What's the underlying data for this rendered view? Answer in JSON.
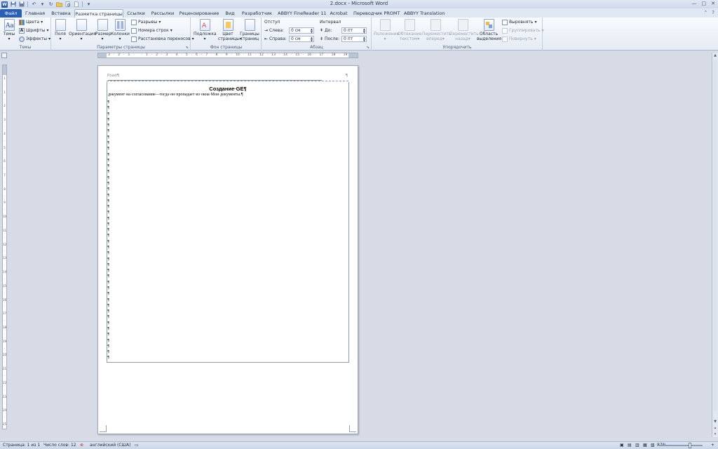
{
  "window": {
    "title": "2.docx - Microsoft Word",
    "app_icon": "W",
    "controls": [
      "—",
      "□",
      "✕"
    ]
  },
  "quick_access": {
    "icons": [
      "save-icon",
      "save-as-icon",
      "undo-icon",
      "redo-icon",
      "open-icon",
      "print-preview-icon",
      "new-icon",
      "customize-icon"
    ]
  },
  "tabs": {
    "file": "Файл",
    "home": "Главная",
    "insert": "Вставка",
    "page_layout": "Разметка страницы",
    "references": "Ссылки",
    "mailings": "Рассылки",
    "review": "Рецензирование",
    "view": "Вид",
    "developer": "Разработчик",
    "finereader": "ABBYY FineReader 11",
    "acrobat": "Acrobat",
    "promt": "Переводчик PROMT",
    "abbyy_translation": "ABBYY Translation"
  },
  "ribbon": {
    "themes": {
      "label": "Темы",
      "themes_btn": "Темы",
      "colors": "Цвета",
      "fonts": "Шрифты",
      "effects": "Эффекты"
    },
    "page_setup": {
      "label": "Параметры страницы",
      "margins": "Поля",
      "orientation": "Ориентация",
      "size": "Размер",
      "columns": "Колонки",
      "breaks": "Разрывы",
      "line_numbers": "Номера строк",
      "hyphenation": "Расстановка переносов"
    },
    "page_background": {
      "label": "Фон страницы",
      "watermark": "Подложка",
      "page_color_1": "Цвет",
      "page_color_2": "страницы",
      "borders_1": "Границы",
      "borders_2": "страниц"
    },
    "paragraph": {
      "label": "Абзац",
      "indent": "Отступ",
      "left": "Слева:",
      "right": "Справа:",
      "left_val": "0 см",
      "right_val": "0 см",
      "spacing": "Интервал",
      "before": "До:",
      "after": "После:",
      "before_val": "0 пт",
      "after_val": "0 пт"
    },
    "arrange": {
      "label": "Упорядочить",
      "position": "Положение",
      "wrap_1": "Обтекание",
      "wrap_2": "текстом",
      "forward_1": "Переместить",
      "forward_2": "вперед",
      "backward_1": "Переместить",
      "backward_2": "назад",
      "selection_1": "Область",
      "selection_2": "выделения",
      "align": "Выровнять",
      "group": "Группировать",
      "rotate": "Повернуть"
    }
  },
  "ruler": {
    "ticks": [
      "3",
      "·",
      "2",
      "·",
      "1",
      "·",
      "",
      "·",
      "1",
      "·",
      "2",
      "·",
      "3",
      "·",
      "4",
      "·",
      "5",
      "·",
      "6",
      "·",
      "7",
      "·",
      "8",
      "·",
      "9",
      "·",
      "10",
      "·",
      "11",
      "·",
      "12",
      "·",
      "13",
      "·",
      "14",
      "·",
      "15",
      "·",
      "16",
      "·",
      "17",
      "·",
      "18",
      "·",
      "19"
    ],
    "vticks": [
      "1",
      "·",
      "1",
      "·",
      "2",
      "·",
      "3",
      "·",
      "4",
      "·",
      "5",
      "·",
      "6",
      "·",
      "7",
      "·",
      "8",
      "·",
      "9",
      "·",
      "10",
      "·",
      "11",
      "·",
      "12",
      "·",
      "13",
      "·",
      "14",
      "·",
      "15",
      "·",
      "16",
      "·",
      "17",
      "·",
      "18",
      "·",
      "19",
      "·",
      "20",
      "·",
      "21",
      "·",
      "22",
      "·",
      "23",
      "·",
      "24",
      "·",
      "25"
    ]
  },
  "document": {
    "header_text": "Роаd¶",
    "header_mark": "¶",
    "title": "Создание·GE¶",
    "line1": "документ·на·согласование—тогда·он·пропадает·из·окна·Мои·документы.¶",
    "para_mark": "¶",
    "para_mark_count": 45
  },
  "status": {
    "page": "Страница: 1 из 1",
    "words": "Число слов: 12",
    "language": "английский (США)",
    "zoom": "87%",
    "zoom_minus": "−",
    "zoom_plus": "+"
  },
  "colors": {
    "file_tab": "#2a5fb5",
    "ribbon_bg": "#e5ebf4",
    "workspace": "#d6dbe6"
  }
}
